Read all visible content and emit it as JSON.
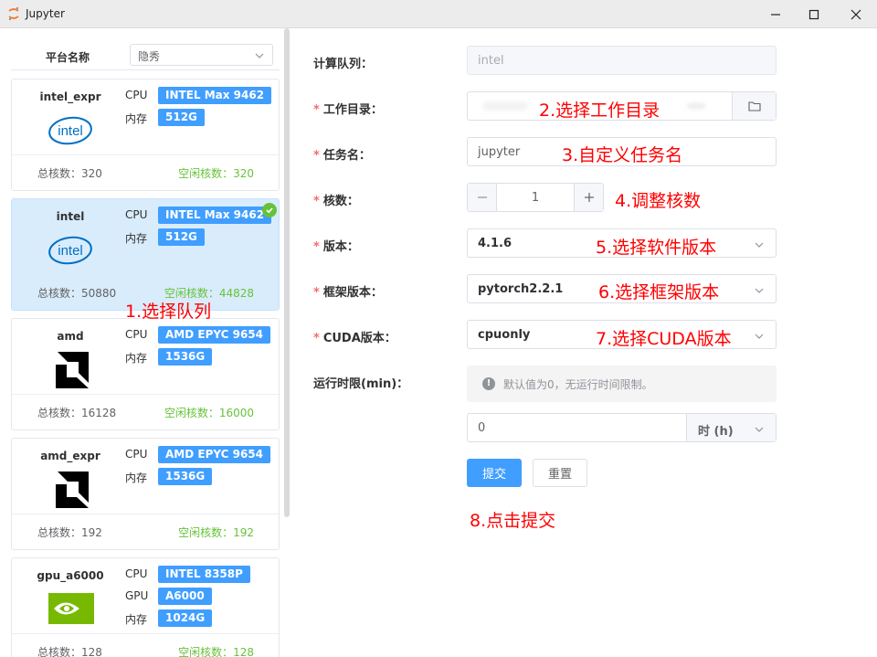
{
  "window": {
    "title": "Jupyter"
  },
  "platform": {
    "label": "平台名称",
    "value": "隐秀"
  },
  "cards": [
    {
      "name": "intel_expr",
      "logo": "intel",
      "specs": [
        {
          "label": "CPU",
          "value": "INTEL Max 9462"
        },
        {
          "label": "内存",
          "value": "512G"
        }
      ],
      "total": "总核数：320",
      "idle": "空闲核数：320",
      "selected": false
    },
    {
      "name": "intel",
      "logo": "intel",
      "specs": [
        {
          "label": "CPU",
          "value": "INTEL Max 9462"
        },
        {
          "label": "内存",
          "value": "512G"
        }
      ],
      "total": "总核数：50880",
      "idle": "空闲核数：44828",
      "selected": true
    },
    {
      "name": "amd",
      "logo": "amd",
      "specs": [
        {
          "label": "CPU",
          "value": "AMD EPYC 9654"
        },
        {
          "label": "内存",
          "value": "1536G"
        }
      ],
      "total": "总核数：16128",
      "idle": "空闲核数：16000",
      "selected": false
    },
    {
      "name": "amd_expr",
      "logo": "amd",
      "specs": [
        {
          "label": "CPU",
          "value": "AMD EPYC 9654"
        },
        {
          "label": "内存",
          "value": "1536G"
        }
      ],
      "total": "总核数：192",
      "idle": "空闲核数：192",
      "selected": false
    },
    {
      "name": "gpu_a6000",
      "logo": "nvidia",
      "specs": [
        {
          "label": "CPU",
          "value": "INTEL 8358P"
        },
        {
          "label": "GPU",
          "value": "A6000"
        },
        {
          "label": "内存",
          "value": "1024G"
        }
      ],
      "total": "总核数：128",
      "idle": "空闲核数：128",
      "selected": false
    }
  ],
  "form": {
    "queue": {
      "label": "计算队列：",
      "value": "intel"
    },
    "workdir": {
      "label": "工作目录："
    },
    "taskname": {
      "label": "任务名：",
      "value": "jupyter"
    },
    "cores": {
      "label": "核数：",
      "value": "1"
    },
    "version": {
      "label": "版本：",
      "value": "4.1.6"
    },
    "framework": {
      "label": "框架版本：",
      "value": "pytorch2.2.1"
    },
    "cuda": {
      "label": "CUDA版本：",
      "value": "cpuonly"
    },
    "timelimit": {
      "label": "运行时限(min)：",
      "hint": "默认值为0，无运行时间限制。",
      "value": "0",
      "unit": "时 (h)"
    },
    "submit_label": "提交",
    "reset_label": "重置"
  },
  "annotations": {
    "a1": "1.选择队列",
    "a2": "2.选择工作目录",
    "a3": "3.自定义任务名",
    "a4": "4.调整核数",
    "a5": "5.选择软件版本",
    "a6": "6.选择框架版本",
    "a7": "7.选择CUDA版本",
    "a8": "8.点击提交"
  },
  "colors": {
    "accent": "#409eff",
    "success": "#67c23a",
    "annotation": "#ff0000",
    "required": "#f56c6c",
    "selected_card": "#d9ecfb"
  },
  "icons": [
    "jupyter-icon",
    "minimize-icon",
    "maximize-icon",
    "close-icon",
    "chevron-down-icon",
    "intel-logo",
    "amd-logo",
    "nvidia-logo",
    "check-circle-icon",
    "folder-icon",
    "minus-icon",
    "plus-icon",
    "info-icon"
  ]
}
